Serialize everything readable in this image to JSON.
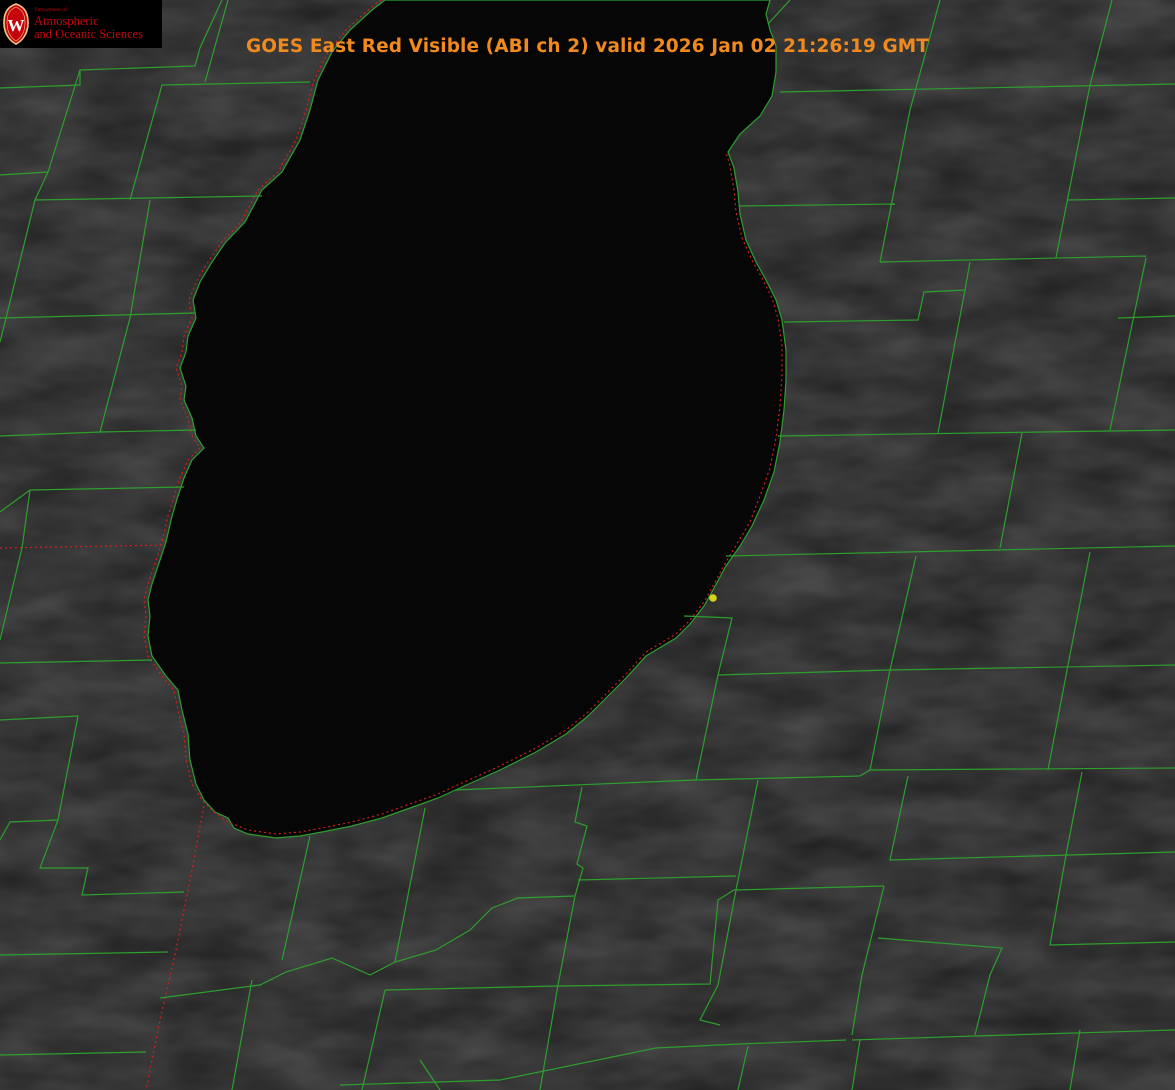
{
  "title": "GOES East Red Visible (ABI ch 2) valid 2026 Jan 02 21:26:19 GMT",
  "logo": {
    "department": "Department of",
    "line1": "Atmospheric",
    "line2": "and Oceanic Sciences",
    "seal_letter": "W"
  },
  "colors": {
    "land": "#1e1e1e",
    "lake": "#060606",
    "county_lines": "#2e9e2e",
    "state_border": "#d42020",
    "title": "#f08a1e",
    "logo_text": "#c5050c",
    "station_marker": "#d4d420"
  }
}
